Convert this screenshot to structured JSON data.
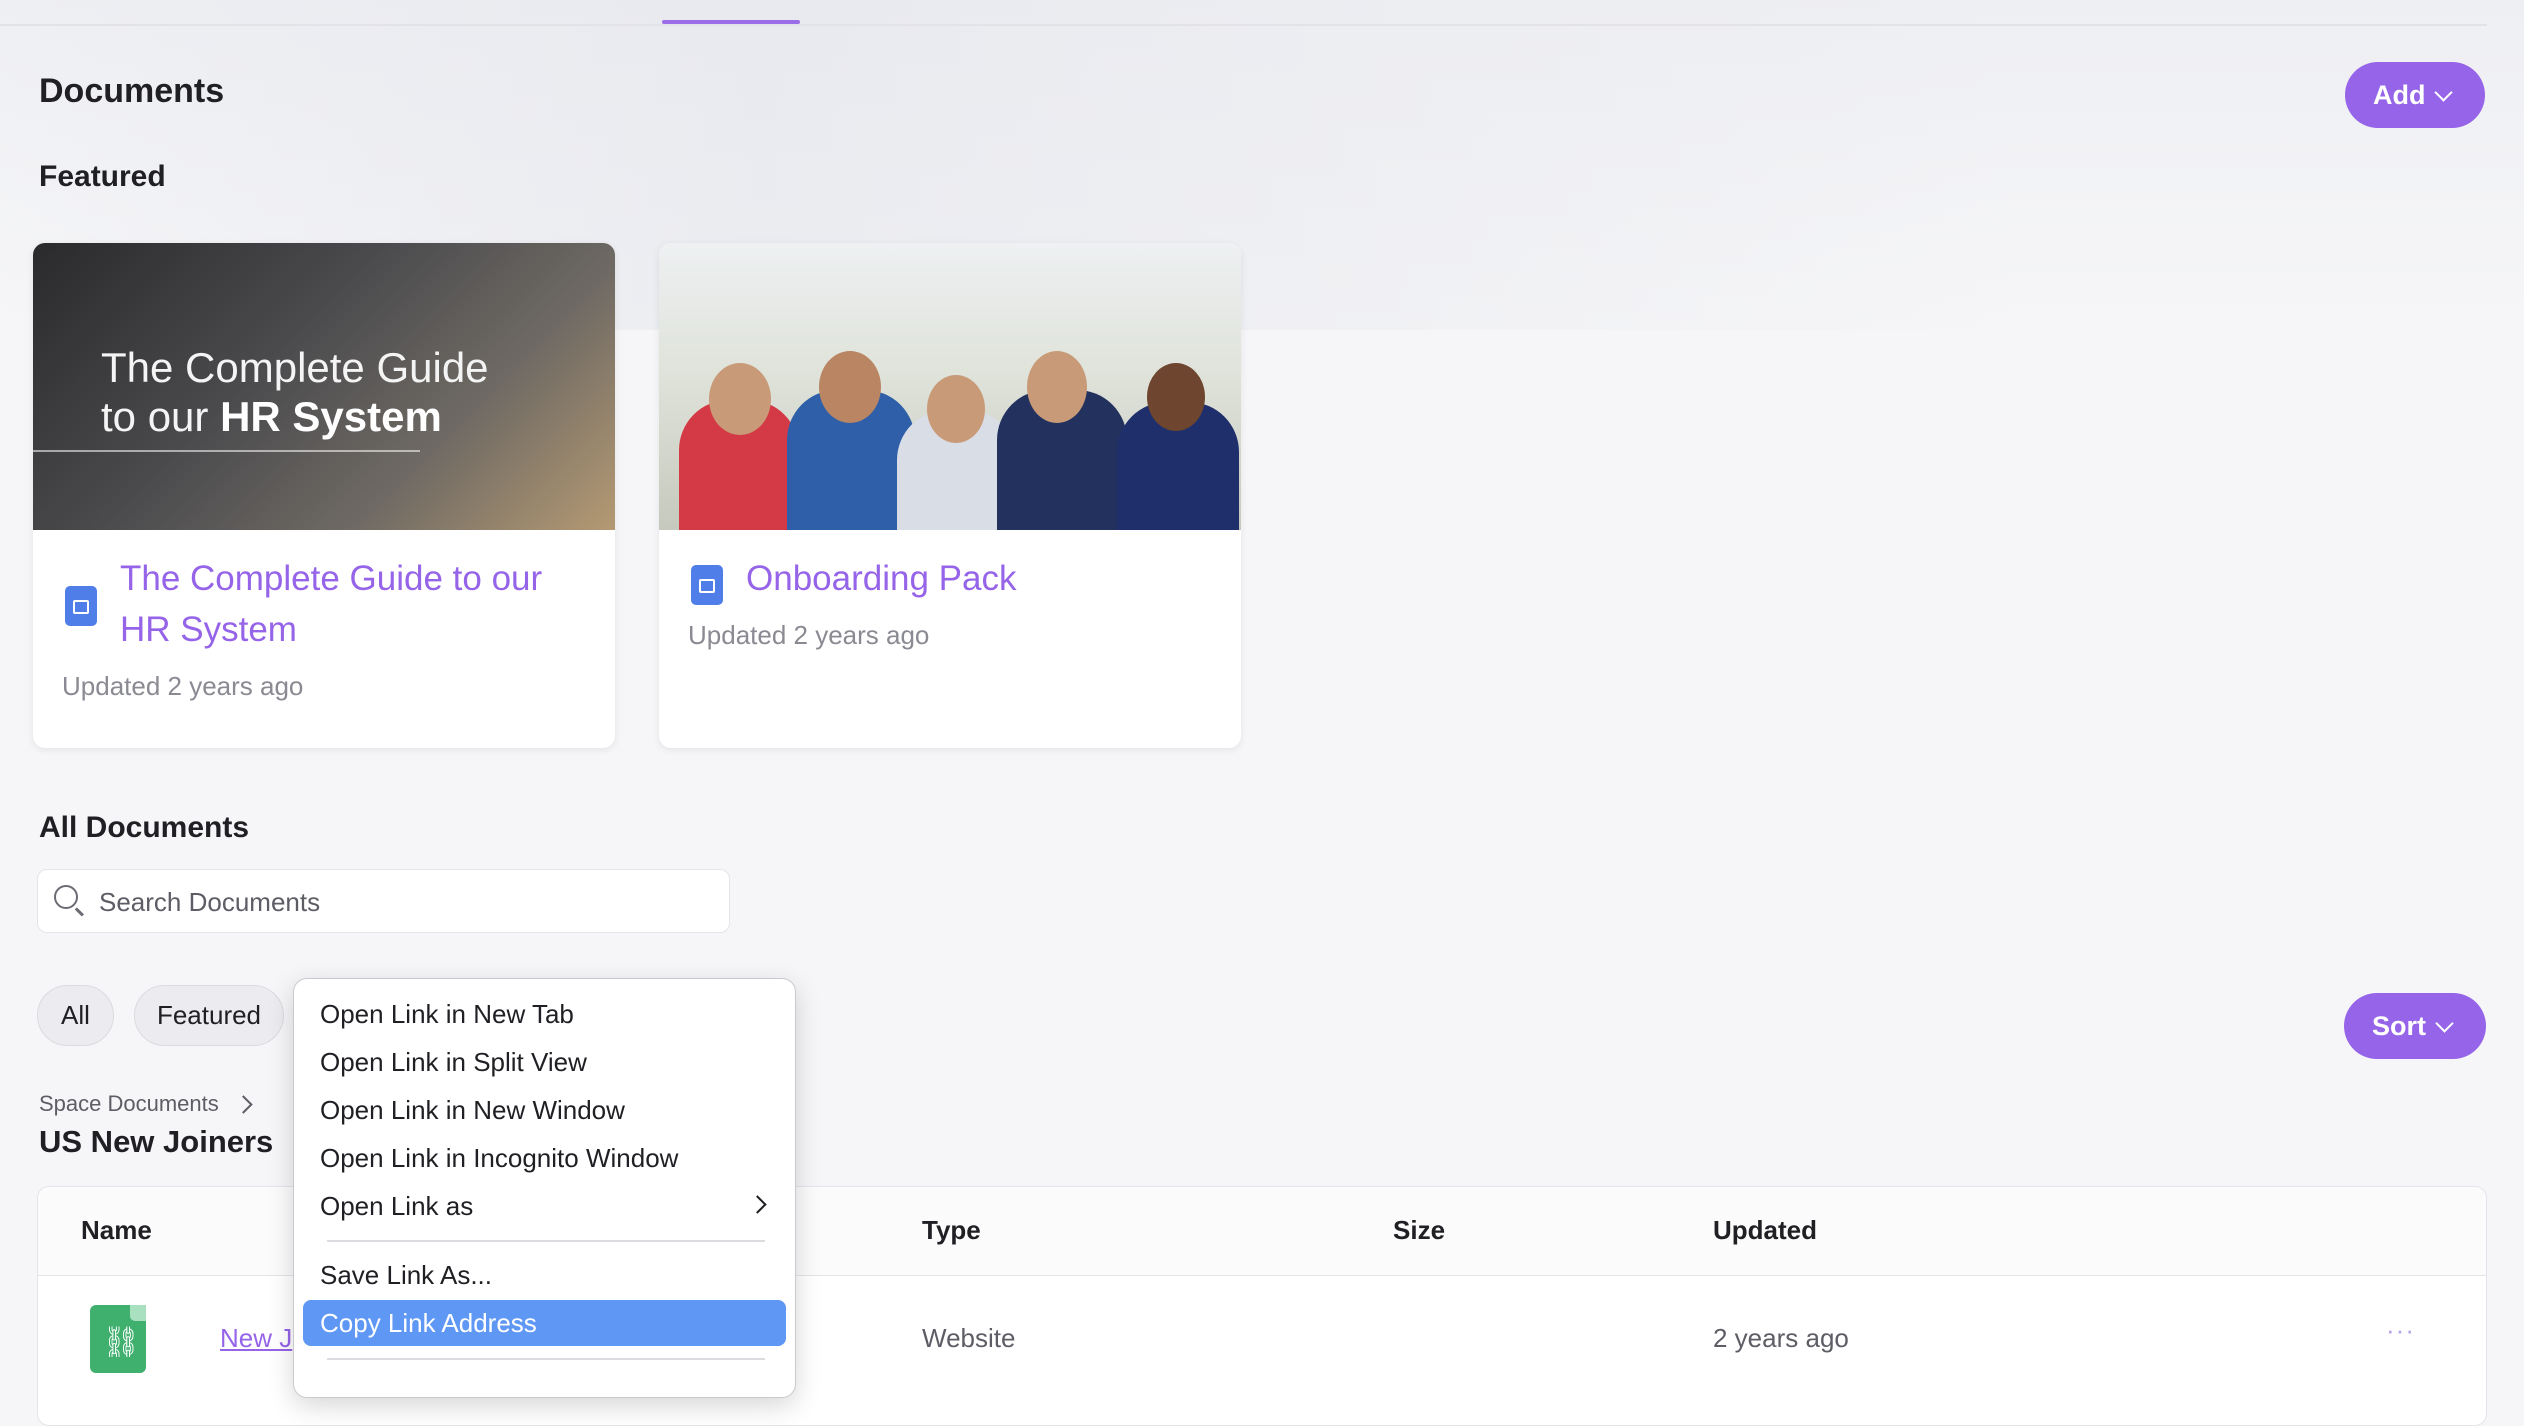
{
  "header": {
    "title": "Documents",
    "add_label": "Add"
  },
  "featured": {
    "heading": "Featured",
    "cards": [
      {
        "thumb_line1": "The Complete Guide",
        "thumb_line2_prefix": "to our ",
        "thumb_line2_bold": "HR System",
        "title_line1": "The Complete Guide to our",
        "title_line2": "HR System",
        "updated": "Updated 2 years ago"
      },
      {
        "title": "Onboarding Pack",
        "updated": "Updated 2 years ago"
      }
    ]
  },
  "all_documents": {
    "heading": "All Documents",
    "search_placeholder": "Search Documents",
    "filters": [
      "All",
      "Featured"
    ],
    "sort_label": "Sort",
    "breadcrumb": "Space Documents",
    "folder_title": "US New Joiners",
    "table": {
      "headers": [
        "Name",
        "Type",
        "Size",
        "Updated"
      ],
      "rows": [
        {
          "name": "New J",
          "type": "Website",
          "size": "",
          "updated": "2 years ago",
          "more": "···"
        }
      ]
    }
  },
  "context_menu": {
    "items": [
      "Open Link in New Tab",
      "Open Link in Split View",
      "Open Link in New Window",
      "Open Link in Incognito Window",
      "Open Link as",
      "Save Link As...",
      "Copy Link Address"
    ]
  },
  "colors": {
    "accent": "#9564e8",
    "highlight": "#5f97f4"
  }
}
